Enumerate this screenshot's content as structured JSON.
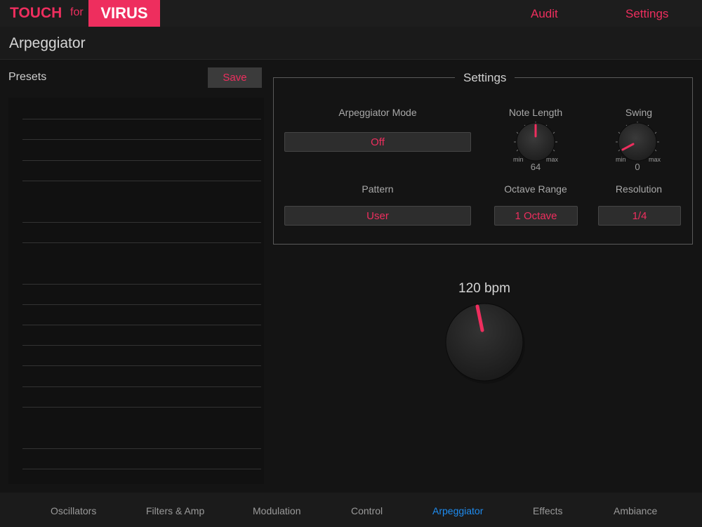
{
  "app": {
    "logo_touch": "TOUCH",
    "logo_for": "for",
    "logo_virus": "VIRUS",
    "nav": [
      {
        "label": "Audit"
      },
      {
        "label": "Settings"
      }
    ]
  },
  "page": {
    "title": "Arpeggiator"
  },
  "presets": {
    "label": "Presets",
    "save_label": "Save"
  },
  "settings": {
    "title": "Settings",
    "arp_mode": {
      "label": "Arpeggiator Mode",
      "value": "Off"
    },
    "note_length": {
      "label": "Note Length",
      "value": "64",
      "min_label": "min",
      "max_label": "max"
    },
    "swing": {
      "label": "Swing",
      "value": "0",
      "min_label": "min",
      "max_label": "max"
    },
    "pattern": {
      "label": "Pattern",
      "value": "User"
    },
    "octave_range": {
      "label": "Octave Range",
      "value": "1 Octave"
    },
    "resolution": {
      "label": "Resolution",
      "value": "1/4"
    }
  },
  "tempo": {
    "label": "120 bpm"
  },
  "tabs": [
    {
      "label": "Oscillators"
    },
    {
      "label": "Filters & Amp"
    },
    {
      "label": "Modulation"
    },
    {
      "label": "Control"
    },
    {
      "label": "Arpeggiator",
      "active": true
    },
    {
      "label": "Effects"
    },
    {
      "label": "Ambiance"
    }
  ],
  "colors": {
    "accent": "#ee2e5e",
    "active_tab": "#1e8cf0",
    "background": "#141414"
  }
}
